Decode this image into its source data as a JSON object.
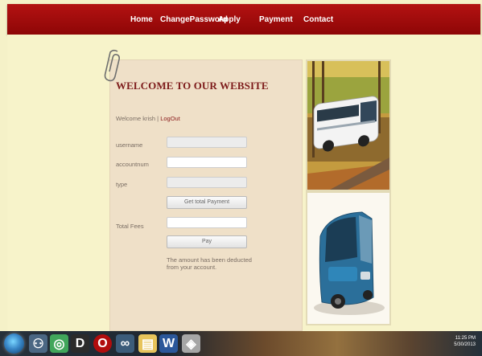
{
  "nav": {
    "items": [
      {
        "label": "Home"
      },
      {
        "label": "ChangePassword"
      },
      {
        "label": "Apply"
      },
      {
        "label": "Payment"
      },
      {
        "label": "Contact"
      }
    ]
  },
  "content": {
    "welcome_title": "WELCOME TO OUR WEBSITE",
    "welcome_user": "Welcome krish",
    "separator": "|",
    "logout_label": "LogOut",
    "labels": {
      "username": "username",
      "accountnum": "accountnum",
      "type": "type",
      "total_fees": "Total Fees"
    },
    "fields": {
      "username_value": "",
      "accountnum_value": "",
      "type_value": "",
      "total_fees_value": ""
    },
    "buttons": {
      "get_total_payment": "Get total Payment",
      "pay": "Pay"
    },
    "message": "The amount has been deducted from your account."
  },
  "images": [
    {
      "name": "white-coach-bus-autumn-road"
    },
    {
      "name": "blue-coach-bus"
    }
  ],
  "taskbar": {
    "time": "11:25 PM",
    "date": "5/30/2013"
  },
  "colors": {
    "header": "#a30f0f",
    "page_bg": "#f5f1c8",
    "panel_bg": "#efe0c8",
    "title": "#7d1b1b"
  }
}
